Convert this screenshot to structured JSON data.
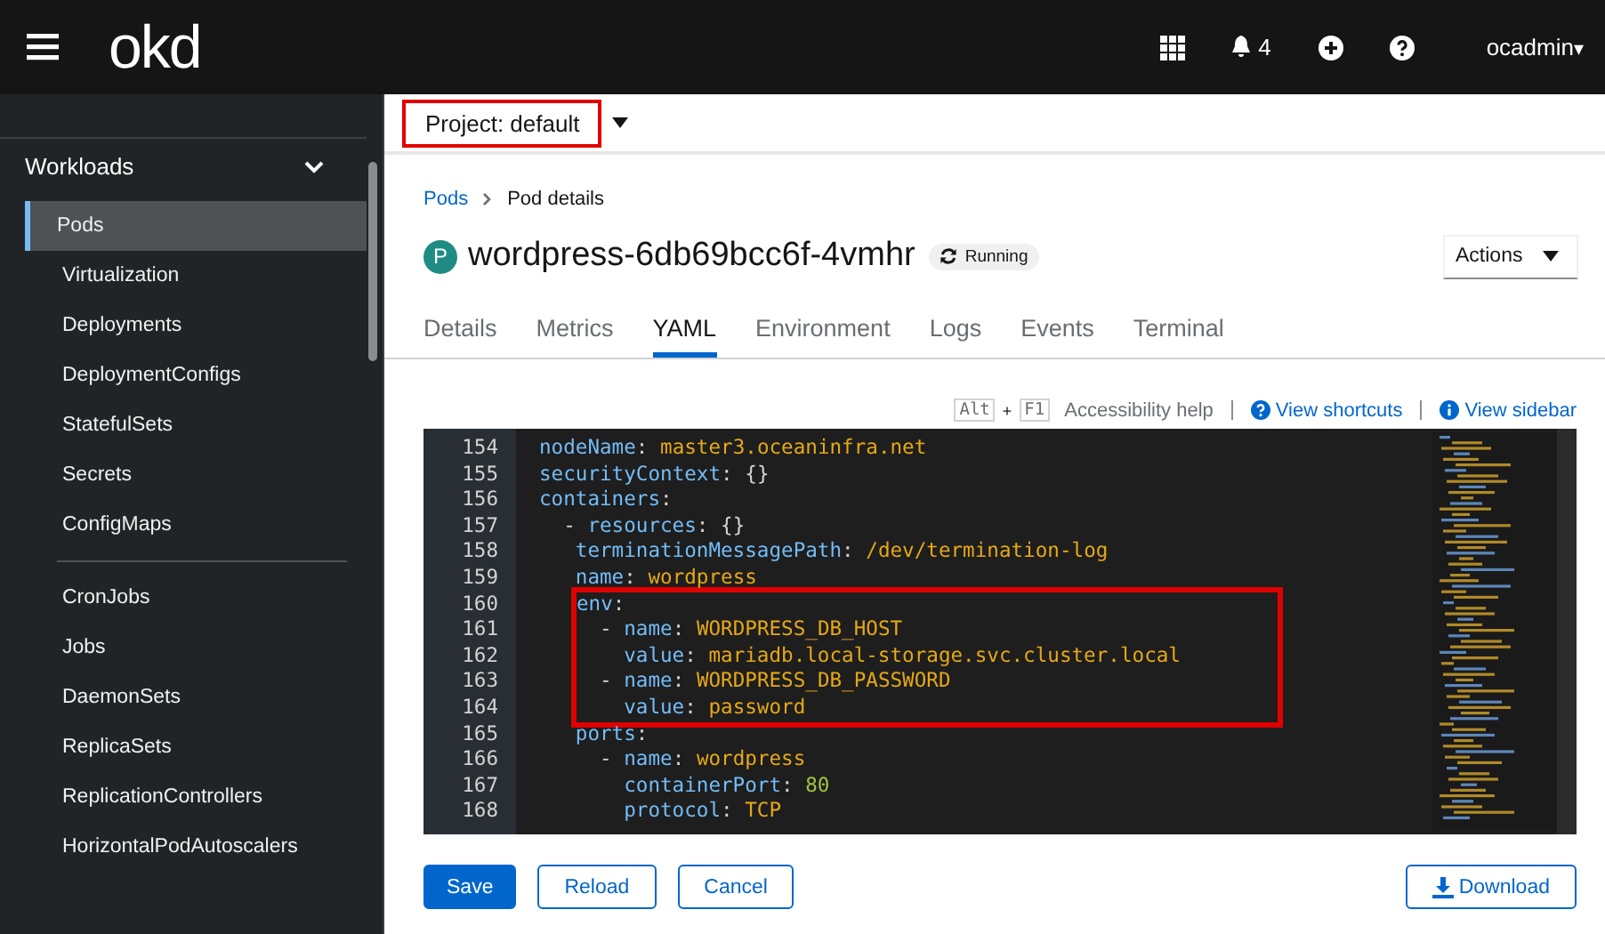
{
  "masthead": {
    "logo": "okd",
    "notifications_count": "4",
    "user": "ocadmin",
    "user_caret": "▾"
  },
  "sidebar": {
    "section": {
      "label": "Workloads",
      "expanded": true
    },
    "groups": [
      [
        {
          "label": "Pods",
          "selected": true
        },
        {
          "label": "Virtualization",
          "selected": false
        },
        {
          "label": "Deployments",
          "selected": false
        },
        {
          "label": "DeploymentConfigs",
          "selected": false
        },
        {
          "label": "StatefulSets",
          "selected": false
        },
        {
          "label": "Secrets",
          "selected": false
        },
        {
          "label": "ConfigMaps",
          "selected": false
        }
      ],
      [
        {
          "label": "CronJobs",
          "selected": false
        },
        {
          "label": "Jobs",
          "selected": false
        },
        {
          "label": "DaemonSets",
          "selected": false
        },
        {
          "label": "ReplicaSets",
          "selected": false
        },
        {
          "label": "ReplicationControllers",
          "selected": false
        },
        {
          "label": "HorizontalPodAutoscalers",
          "selected": false
        }
      ]
    ]
  },
  "project": {
    "label": "Project: default",
    "outlined": true
  },
  "breadcrumb": [
    {
      "label": "Pods",
      "kind": "link"
    },
    {
      "label": "Pod details",
      "kind": "current"
    }
  ],
  "title": {
    "badge": "P",
    "name": "wordpress-6db69bcc6f-4vmhr",
    "status": "Running"
  },
  "actions": "Actions",
  "tabs": [
    {
      "label": "Details",
      "selected": false
    },
    {
      "label": "Metrics",
      "selected": false
    },
    {
      "label": "YAML",
      "selected": true
    },
    {
      "label": "Environment",
      "selected": false
    },
    {
      "label": "Logs",
      "selected": false
    },
    {
      "label": "Events",
      "selected": false
    },
    {
      "label": "Terminal",
      "selected": false
    }
  ],
  "editor_toolbar": {
    "keys": [
      "Alt",
      "F1"
    ],
    "plus": "+",
    "help": "Accessibility help",
    "shortcuts": "View shortcuts",
    "sidebar": "View sidebar"
  },
  "code": [
    {
      "num": "154",
      "outlined": false,
      "parts": [
        {
          "kind": "key",
          "text": "nodeName"
        },
        {
          "kind": "punct",
          "text": ":"
        },
        {
          "kind": "string",
          "text": "master3.oceaninfra.net"
        }
      ]
    },
    {
      "num": "155",
      "outlined": false,
      "parts": [
        {
          "kind": "key",
          "text": "securityContext"
        },
        {
          "kind": "punct",
          "text": ":"
        },
        {
          "kind": "punct",
          "text": "{}"
        }
      ]
    },
    {
      "num": "156",
      "outlined": false,
      "parts": [
        {
          "kind": "key",
          "text": "containers"
        },
        {
          "kind": "punct",
          "text": ":"
        }
      ],
      "children": [
        {
          "num": "157",
          "outlined": false,
          "parts": [
            {
              "kind": "dash",
              "text": "-"
            },
            {
              "kind": "key",
              "text": "resources"
            },
            {
              "kind": "punct",
              "text": ":"
            },
            {
              "kind": "punct",
              "text": "{}"
            }
          ],
          "children": [
            {
              "num": "158",
              "outlined": false,
              "parts": [
                {
                  "kind": "key",
                  "text": "terminationMessagePath"
                },
                {
                  "kind": "punct",
                  "text": ":"
                },
                {
                  "kind": "string",
                  "text": "/dev/termination-log"
                }
              ]
            },
            {
              "num": "159",
              "outlined": false,
              "parts": [
                {
                  "kind": "key",
                  "text": "name"
                },
                {
                  "kind": "punct",
                  "text": ":"
                },
                {
                  "kind": "string",
                  "text": "wordpress"
                }
              ]
            },
            {
              "num": "160",
              "outlined": true,
              "parts": [
                {
                  "kind": "key",
                  "text": "env"
                },
                {
                  "kind": "punct",
                  "text": ":"
                }
              ],
              "children": [
                {
                  "num": "161",
                  "outlined": true,
                  "parts": [
                    {
                      "kind": "dash",
                      "text": "-"
                    },
                    {
                      "kind": "key",
                      "text": "name"
                    },
                    {
                      "kind": "punct",
                      "text": ":"
                    },
                    {
                      "kind": "string",
                      "text": "WORDPRESS_DB_HOST"
                    }
                  ],
                  "children": [
                    {
                      "num": "162",
                      "outlined": true,
                      "parts": [
                        {
                          "kind": "key",
                          "text": "value"
                        },
                        {
                          "kind": "punct",
                          "text": ":"
                        },
                        {
                          "kind": "string",
                          "text": "mariadb.local-storage.svc.cluster.local"
                        }
                      ]
                    }
                  ]
                },
                {
                  "num": "163",
                  "outlined": true,
                  "parts": [
                    {
                      "kind": "dash",
                      "text": "-"
                    },
                    {
                      "kind": "key",
                      "text": "name"
                    },
                    {
                      "kind": "punct",
                      "text": ":"
                    },
                    {
                      "kind": "string",
                      "text": "WORDPRESS_DB_PASSWORD"
                    }
                  ],
                  "children": [
                    {
                      "num": "164",
                      "outlined": true,
                      "parts": [
                        {
                          "kind": "key",
                          "text": "value"
                        },
                        {
                          "kind": "punct",
                          "text": ":"
                        },
                        {
                          "kind": "string",
                          "text": "password"
                        }
                      ]
                    }
                  ]
                }
              ]
            },
            {
              "num": "165",
              "outlined": false,
              "parts": [
                {
                  "kind": "key",
                  "text": "ports"
                },
                {
                  "kind": "punct",
                  "text": ":"
                }
              ],
              "children": [
                {
                  "num": "166",
                  "outlined": false,
                  "parts": [
                    {
                      "kind": "dash",
                      "text": "-"
                    },
                    {
                      "kind": "key",
                      "text": "name"
                    },
                    {
                      "kind": "punct",
                      "text": ":"
                    },
                    {
                      "kind": "string",
                      "text": "wordpress"
                    }
                  ],
                  "children": [
                    {
                      "num": "167",
                      "outlined": false,
                      "parts": [
                        {
                          "kind": "key",
                          "text": "containerPort"
                        },
                        {
                          "kind": "punct",
                          "text": ":"
                        },
                        {
                          "kind": "number",
                          "text": "80"
                        }
                      ]
                    },
                    {
                      "num": "168",
                      "outlined": false,
                      "parts": [
                        {
                          "kind": "key",
                          "text": "protocol"
                        },
                        {
                          "kind": "punct",
                          "text": ":"
                        },
                        {
                          "kind": "string",
                          "text": "TCP"
                        }
                      ]
                    }
                  ]
                }
              ]
            }
          ]
        }
      ]
    }
  ],
  "buttons": [
    {
      "label": "Save",
      "kind": "primary"
    },
    {
      "label": "Reload",
      "kind": "secondary"
    },
    {
      "label": "Cancel",
      "kind": "secondary"
    }
  ],
  "download": "Download"
}
